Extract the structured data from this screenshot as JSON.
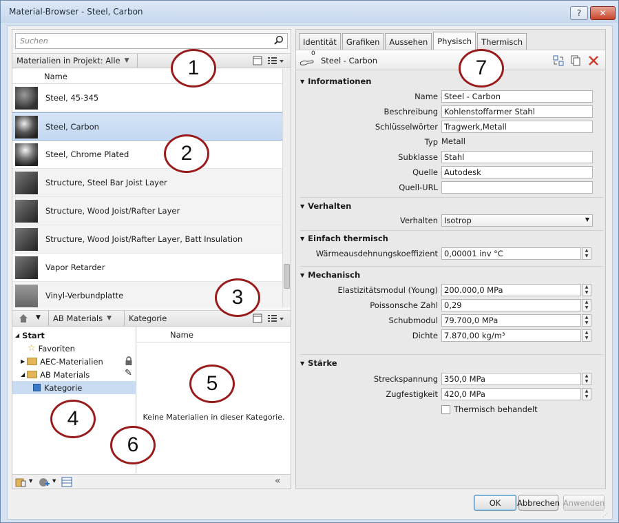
{
  "window": {
    "title": "Material-Browser - Steel, Carbon",
    "help_label": "?",
    "close_label": "✕"
  },
  "search": {
    "placeholder": "Suchen"
  },
  "project_filter": {
    "label": "Materialien in Projekt: Alle"
  },
  "material_list": {
    "column_header": "Name",
    "items": [
      {
        "name": "Steel, 45-345"
      },
      {
        "name": "Steel, Carbon",
        "selected": true
      },
      {
        "name": "Steel, Chrome Plated"
      },
      {
        "name": "Structure, Steel Bar Joist Layer"
      },
      {
        "name": "Structure, Wood Joist/Rafter Layer"
      },
      {
        "name": "Structure, Wood Joist/Rafter Layer, Batt Insulation"
      },
      {
        "name": "Vapor Retarder"
      },
      {
        "name": "Vinyl-Verbundplatte"
      }
    ]
  },
  "library_breadcrumb": {
    "items": [
      "AB Materials",
      "Kategorie"
    ]
  },
  "library_tree": {
    "root": "Start",
    "items": [
      {
        "label": "Favoriten",
        "icon": "star-icon"
      },
      {
        "label": "AEC-Materialien",
        "icon": "folder-icon",
        "badge": "lock-icon"
      },
      {
        "label": "AB Materials",
        "icon": "folder-icon",
        "badge": "pencil-icon"
      },
      {
        "label": "Kategorie",
        "icon": "category-icon",
        "selected": true
      }
    ]
  },
  "category_list": {
    "column_header": "Name",
    "empty_text": "Keine Materialien in dieser Kategorie."
  },
  "tabs": [
    {
      "label": "Identität"
    },
    {
      "label": "Grafiken"
    },
    {
      "label": "Aussehen"
    },
    {
      "label": "Physisch",
      "active": true
    },
    {
      "label": "Thermisch"
    }
  ],
  "asset": {
    "name": "Steel - Carbon",
    "usage_count": "0"
  },
  "sections": {
    "info": {
      "title": "Informationen",
      "name_label": "Name",
      "name_value": "Steel - Carbon",
      "desc_label": "Beschreibung",
      "desc_value": "Kohlenstoffarmer Stahl",
      "keywords_label": "Schlüsselwörter",
      "keywords_value": "Tragwerk,Metall",
      "type_label": "Typ",
      "type_value": "Metall",
      "subclass_label": "Subklasse",
      "subclass_value": "Stahl",
      "source_label": "Quelle",
      "source_value": "Autodesk",
      "url_label": "Quell-URL",
      "url_value": ""
    },
    "behavior": {
      "title": "Verhalten",
      "behavior_label": "Verhalten",
      "behavior_value": "Isotrop"
    },
    "thermal": {
      "title": "Einfach thermisch",
      "expansion_label": "Wärmeausdehnungskoeffizient",
      "expansion_value": "0,00001 inv °C"
    },
    "mechanical": {
      "title": "Mechanisch",
      "young_label": "Elastizitätsmodul (Young)",
      "young_value": "200.000,0 MPa",
      "poisson_label": "Poissonsche Zahl",
      "poisson_value": "0,29",
      "shear_label": "Schubmodul",
      "shear_value": "79.700,0 MPa",
      "density_label": "Dichte",
      "density_value": "7.870,00 kg/m³"
    },
    "strength": {
      "title": "Stärke",
      "yield_label": "Streckspannung",
      "yield_value": "350,0 MPa",
      "tensile_label": "Zugfestigkeit",
      "tensile_value": "420,0 MPa",
      "heat_treated_label": "Thermisch behandelt",
      "heat_treated_checked": false
    }
  },
  "buttons": {
    "ok": "OK",
    "cancel": "Abbrechen",
    "apply": "Anwenden"
  },
  "callouts": [
    "1",
    "2",
    "3",
    "4",
    "5",
    "6",
    "7"
  ],
  "colors": {
    "callout_border": "#9a1b1b",
    "selection": "#c9dcf2",
    "close_button": "#c9462c"
  }
}
